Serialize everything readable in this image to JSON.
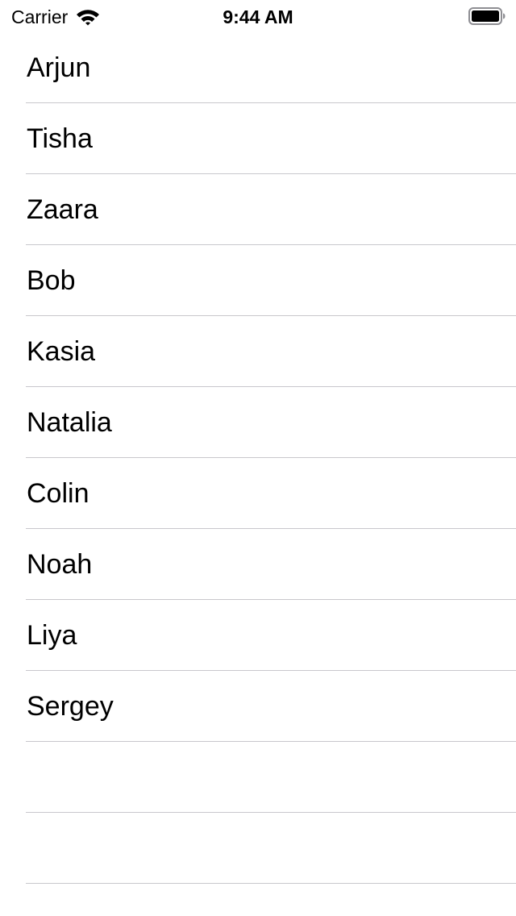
{
  "status_bar": {
    "carrier": "Carrier",
    "time": "9:44 AM",
    "wifi_icon": "wifi-icon",
    "battery_icon": "battery-icon"
  },
  "table": {
    "rows": [
      {
        "label": "Arjun"
      },
      {
        "label": "Tisha"
      },
      {
        "label": "Zaara"
      },
      {
        "label": "Bob"
      },
      {
        "label": "Kasia"
      },
      {
        "label": "Natalia"
      },
      {
        "label": "Colin"
      },
      {
        "label": "Noah"
      },
      {
        "label": "Liya"
      },
      {
        "label": "Sergey"
      },
      {
        "label": ""
      },
      {
        "label": ""
      }
    ],
    "separator_color": "#c8c7cc",
    "text_color": "#000000",
    "background_color": "#ffffff"
  }
}
